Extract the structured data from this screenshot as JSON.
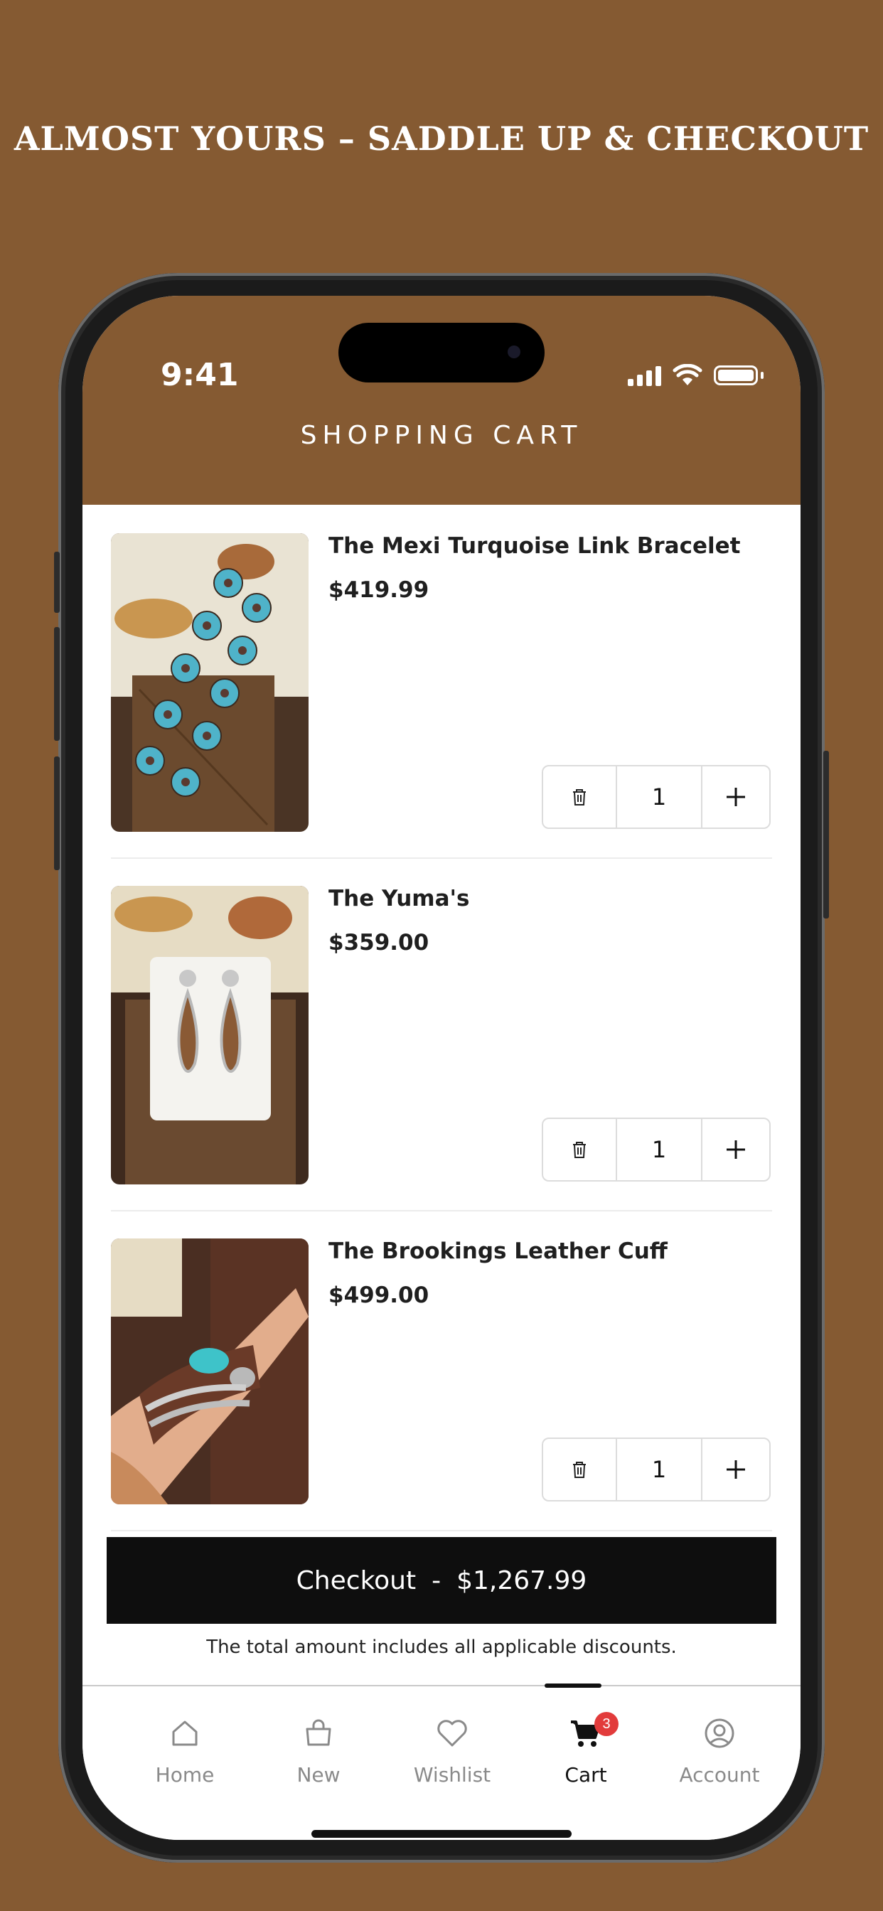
{
  "headline": "ALMOST YOURS – SADDLE UP & CHECKOUT",
  "status_bar": {
    "time": "9:41"
  },
  "header": {
    "title": "SHOPPING CART"
  },
  "cart_items": [
    {
      "name": "The Mexi Turquoise Link Bracelet",
      "price": "$419.99",
      "quantity": "1"
    },
    {
      "name": "The Yuma's",
      "price": "$359.00",
      "quantity": "1"
    },
    {
      "name": "The Brookings Leather Cuff",
      "price": "$499.00",
      "quantity": "1"
    }
  ],
  "checkout": {
    "label": "Checkout",
    "separator": "-",
    "total": "$1,267.99"
  },
  "note": "The total amount includes all applicable discounts.",
  "tabs": [
    {
      "label": "Home",
      "icon": "home-icon"
    },
    {
      "label": "New",
      "icon": "bag-icon"
    },
    {
      "label": "Wishlist",
      "icon": "heart-icon"
    },
    {
      "label": "Cart",
      "icon": "cart-icon",
      "badge": "3",
      "active": true
    },
    {
      "label": "Account",
      "icon": "user-icon"
    }
  ],
  "colors": {
    "brand": "#855a32",
    "checkout": "#0e0e0e",
    "badge": "#e23b3b"
  }
}
